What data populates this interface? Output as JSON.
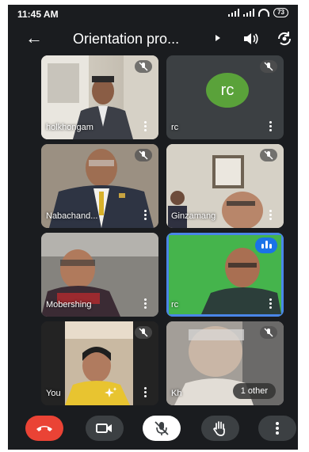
{
  "status_bar": {
    "time": "11:45 AM",
    "battery": "73"
  },
  "header": {
    "title": "Orientation pro...",
    "back_icon": "arrow-left-icon",
    "speaker_icon": "speaker-icon",
    "switch_camera_icon": "switch-camera-icon"
  },
  "participants": [
    {
      "name": "holkhongam",
      "muted": true
    },
    {
      "name": "rc",
      "muted": true,
      "avatar_initials": "rc",
      "avatar_color": "#5aa23a"
    },
    {
      "name": "Nabachand...",
      "muted": true
    },
    {
      "name": "Ginzamang",
      "muted": true
    },
    {
      "name": "Mobershing",
      "muted": false
    },
    {
      "name": "rc",
      "muted": false,
      "speaking": true
    },
    {
      "name": "You",
      "muted": true
    },
    {
      "name": "Kh",
      "muted": true,
      "extra_label": "1 other"
    }
  ],
  "controls": {
    "end_call_icon": "end-call-icon",
    "camera_icon": "video-camera-icon",
    "mic_icon": "mic-off-icon",
    "raise_hand_icon": "raise-hand-icon",
    "more_icon": "more-vertical-icon",
    "end_call_color": "#ea4335"
  },
  "colors": {
    "background": "#1a1c1f",
    "speaking_accent": "#1a73e8"
  }
}
